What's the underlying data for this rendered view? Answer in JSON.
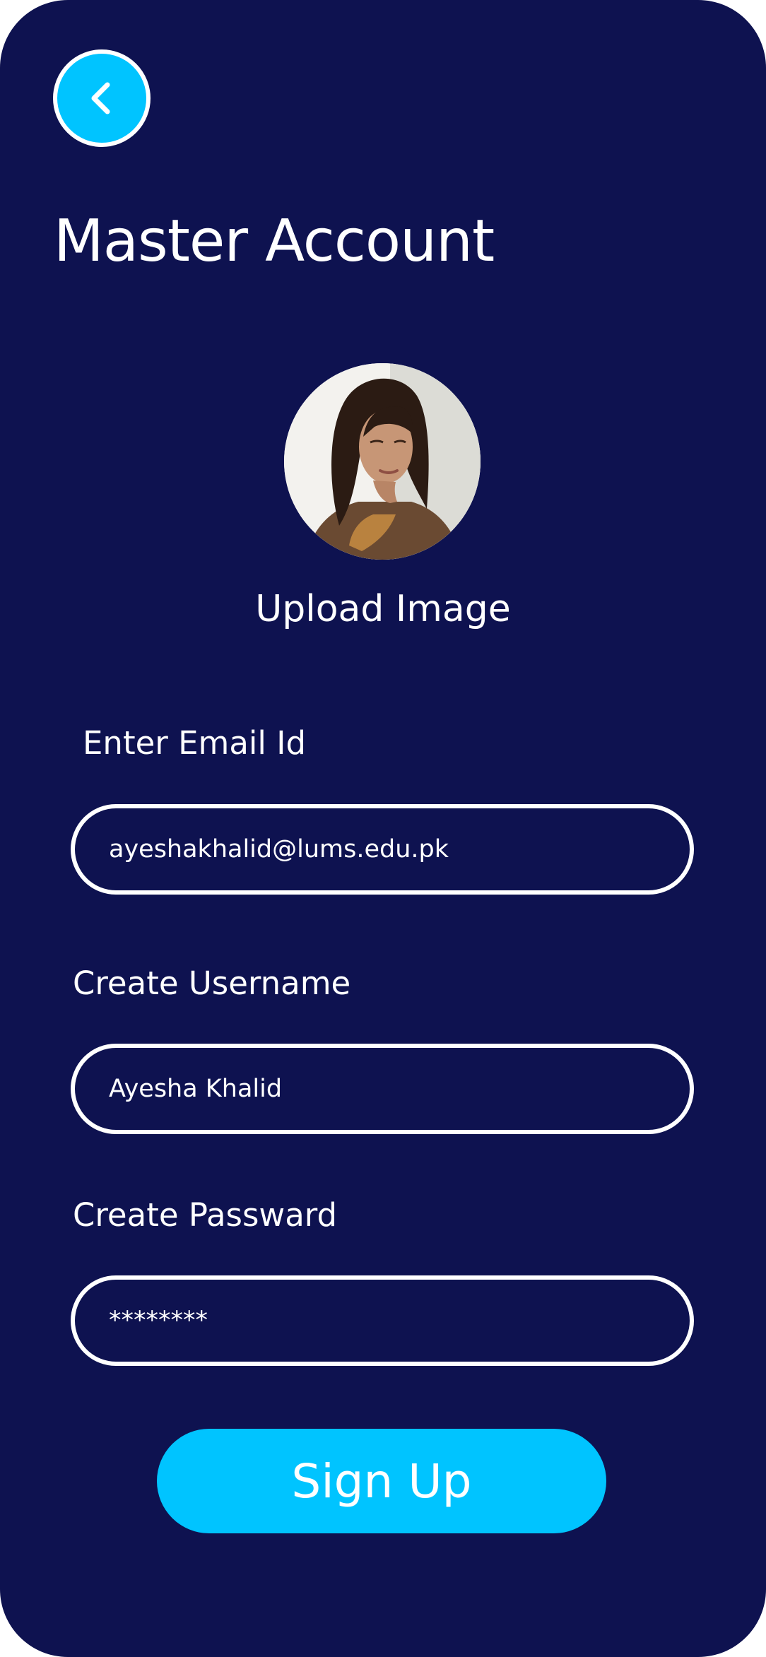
{
  "header": {
    "back_icon": "chevron-left-icon",
    "title": "Master Account"
  },
  "profile": {
    "avatar_description": "profile photo",
    "upload_label": "Upload Image"
  },
  "form": {
    "email": {
      "label": "Enter Email Id",
      "value": "ayeshakhalid@lums.edu.pk"
    },
    "username": {
      "label": "Create Username",
      "value": "Ayesha Khalid"
    },
    "password": {
      "label": "Create Passward",
      "value": "********"
    },
    "submit_label": "Sign Up"
  },
  "colors": {
    "background": "#0e1250",
    "accent": "#00c4ff",
    "text": "#ffffff"
  }
}
